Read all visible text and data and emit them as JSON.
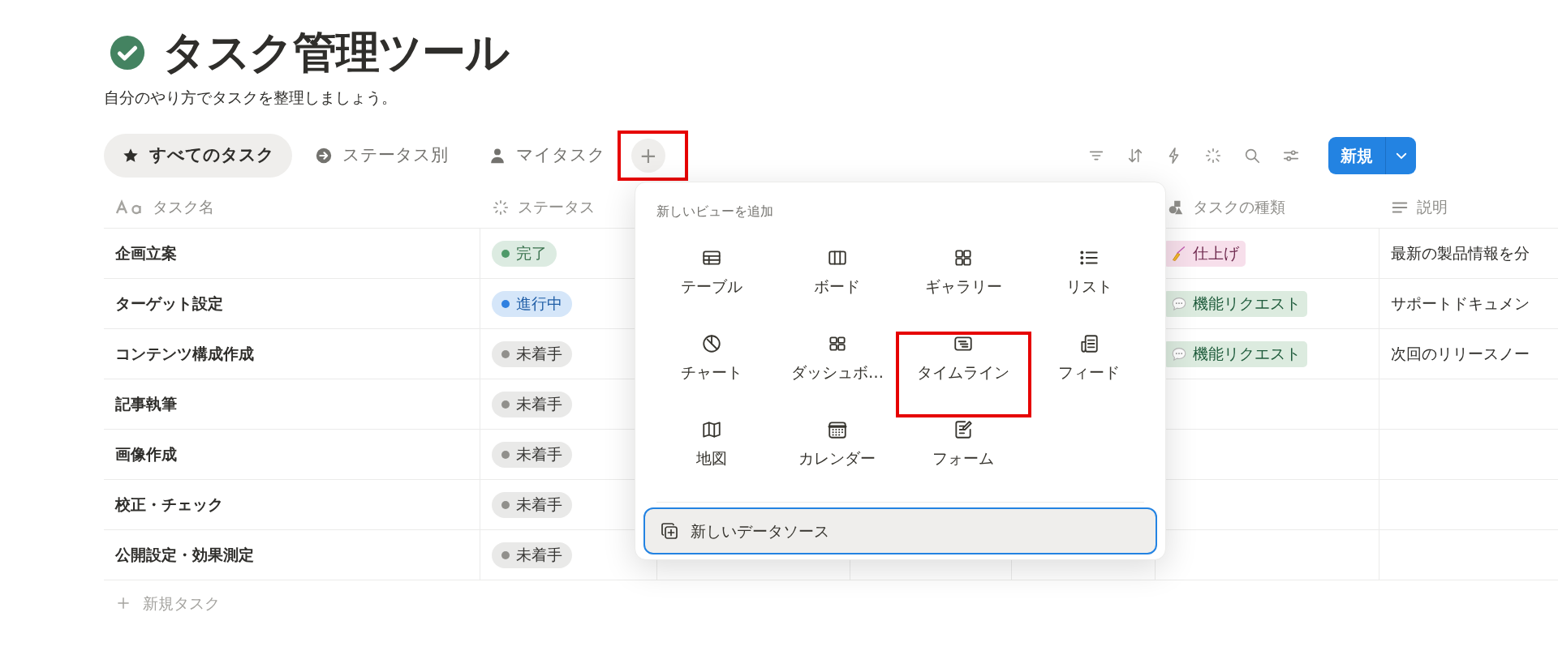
{
  "page": {
    "title": "タスク管理ツール",
    "subtitle": "自分のやり方でタスクを整理しましょう。"
  },
  "view_tabs": [
    {
      "label": "すべてのタスク",
      "kind": "star",
      "selected": true
    },
    {
      "label": "ステータス別",
      "kind": "arrow",
      "selected": false
    },
    {
      "label": "マイタスク",
      "kind": "person",
      "selected": false
    }
  ],
  "add_view_button": {
    "label": "+",
    "annotated": true
  },
  "toolbar": {
    "new_button": "新規"
  },
  "table": {
    "columns": [
      {
        "label": "タスク名",
        "kind": "title"
      },
      {
        "label": "ステータス",
        "kind": "status"
      },
      {
        "kind": "hidden"
      },
      {
        "kind": "hidden"
      },
      {
        "kind": "hidden"
      },
      {
        "label": "タスクの種類",
        "kind": "type"
      },
      {
        "label": "説明",
        "kind": "text"
      }
    ],
    "rows": [
      {
        "name": "企画立案",
        "status": {
          "label": "完了",
          "color": "#4f9a6a"
        },
        "type": {
          "label": "仕上げ",
          "kind": "finish"
        },
        "description": "最新の製品情報を分"
      },
      {
        "name": "ターゲット設定",
        "status": {
          "label": "進行中",
          "color": "#2f80e0"
        },
        "type": {
          "label": "機能リクエスト",
          "kind": "feature_request"
        },
        "description": "サポートドキュメン"
      },
      {
        "name": "コンテンツ構成作成",
        "status": {
          "label": "未着手",
          "color": "#91908c"
        },
        "type": {
          "label": "機能リクエスト",
          "kind": "feature_request"
        },
        "description": "次回のリリースノー"
      },
      {
        "name": "記事執筆",
        "status": {
          "label": "未着手",
          "color": "#91908c"
        }
      },
      {
        "name": "画像作成",
        "status": {
          "label": "未着手",
          "color": "#91908c"
        }
      },
      {
        "name": "校正・チェック",
        "status": {
          "label": "未着手",
          "color": "#91908c"
        }
      },
      {
        "name": "公開設定・効果測定",
        "status": {
          "label": "未着手",
          "color": "#91908c"
        }
      }
    ],
    "new_row": "新規タスク"
  },
  "view_menu": {
    "title": "新しいビューを追加",
    "items": [
      {
        "label": "テーブル",
        "kind": "table",
        "annotated": false
      },
      {
        "label": "ボード",
        "kind": "board",
        "annotated": false
      },
      {
        "label": "ギャラリー",
        "kind": "gallery",
        "annotated": false
      },
      {
        "label": "リスト",
        "kind": "list",
        "annotated": false
      },
      {
        "label": "チャート",
        "kind": "chart",
        "annotated": false
      },
      {
        "label": "ダッシュボ…",
        "kind": "dashboard",
        "annotated": false
      },
      {
        "label": "タイムライン",
        "kind": "timeline",
        "annotated": true
      },
      {
        "label": "フィード",
        "kind": "feed",
        "annotated": false
      },
      {
        "label": "地図",
        "kind": "map",
        "annotated": false
      },
      {
        "label": "カレンダー",
        "kind": "calendar",
        "annotated": false
      },
      {
        "label": "フォーム",
        "kind": "form",
        "annotated": false
      }
    ],
    "footer_button": "新しいデータソース"
  }
}
